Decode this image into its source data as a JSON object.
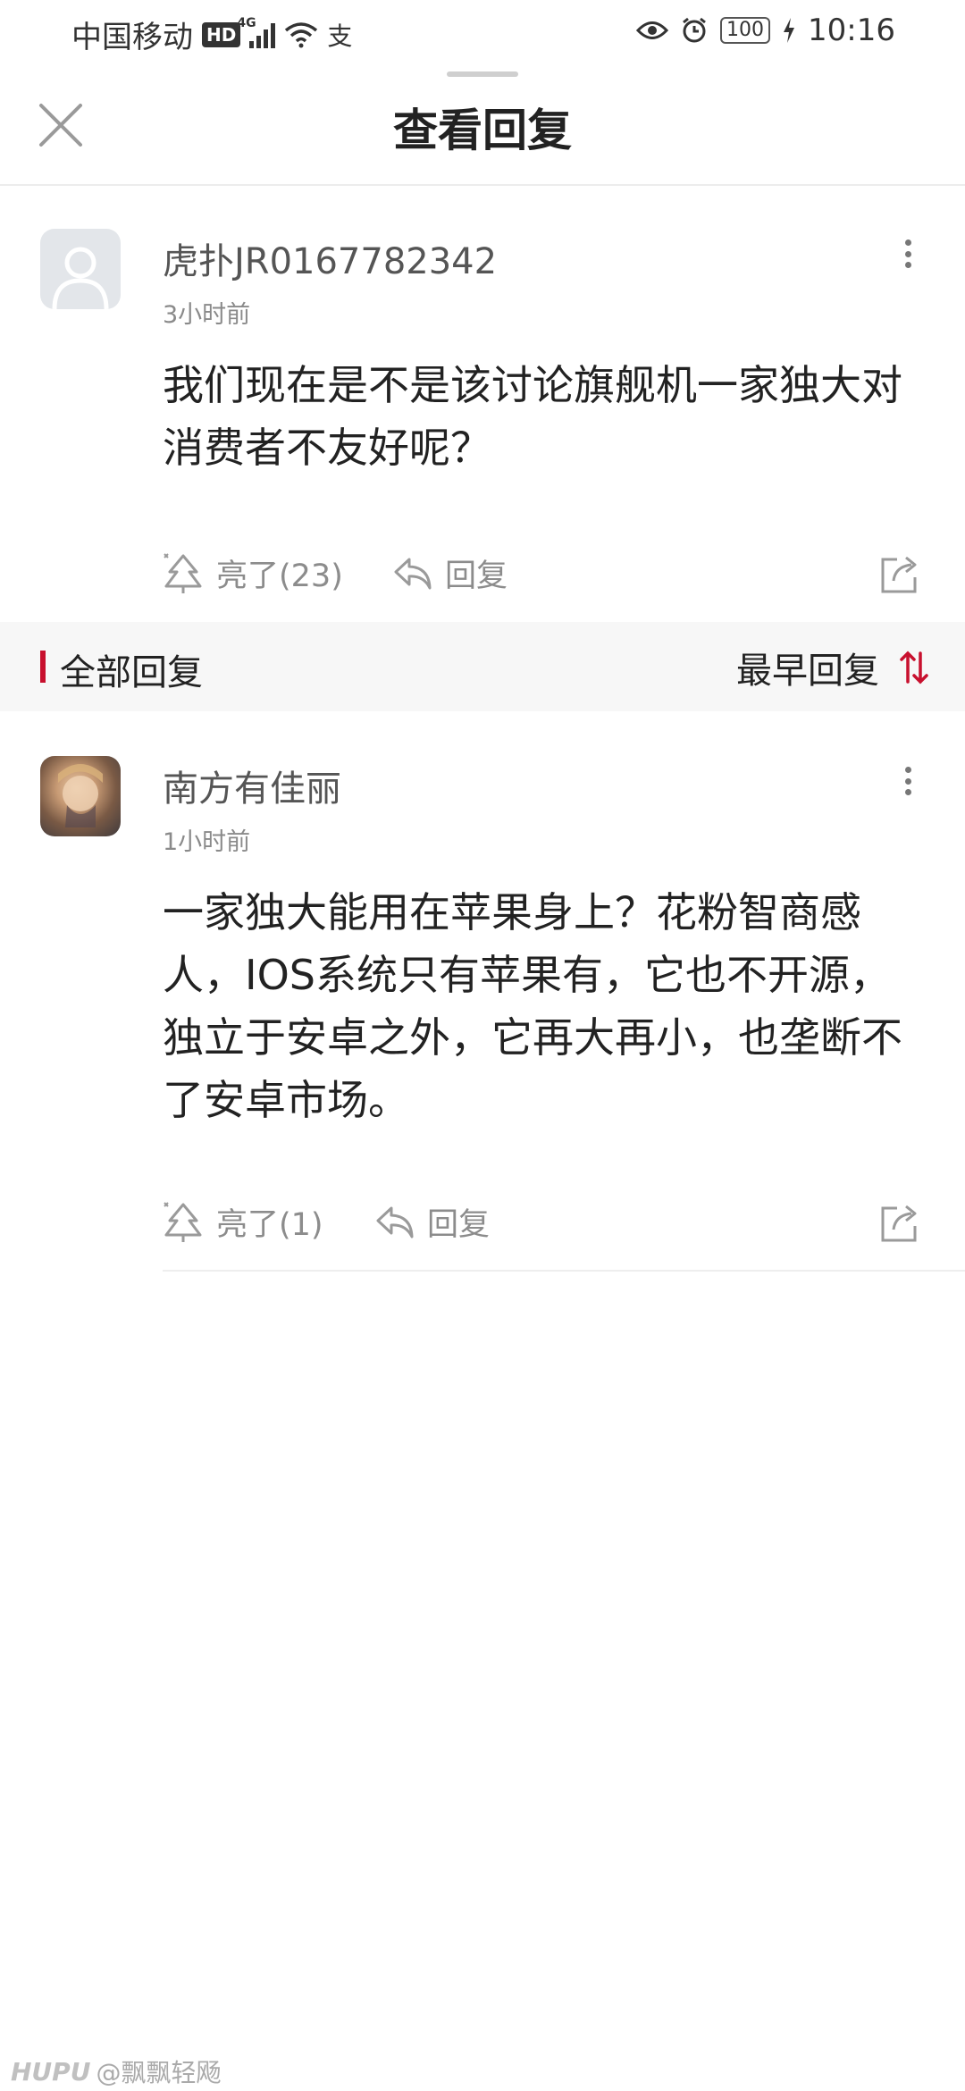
{
  "status_bar": {
    "carrier": "中国移动",
    "hd": "HD",
    "network": "4G",
    "extra_icon": "支",
    "battery": "100",
    "time": "10:16"
  },
  "sheet": {
    "title": "查看回复"
  },
  "original_post": {
    "username": "虎扑JR0167782342",
    "time": "3小时前",
    "text": "我们现在是不是该讨论旗舰机一家独大对消费者不友好呢？",
    "like_label": "亮了(23)",
    "reply_label": "回复"
  },
  "section": {
    "title": "全部回复",
    "sort_label": "最早回复",
    "accent_color": "#c8102e"
  },
  "replies": [
    {
      "username": "南方有佳丽",
      "time": "1小时前",
      "text": "一家独大能用在苹果身上？花粉智商感人，IOS系统只有苹果有，它也不开源，独立于安卓之外，它再大再小，也垄断不了安卓市场。",
      "like_label": "亮了(1)",
      "reply_label": "回复"
    }
  ],
  "watermark": {
    "brand": "HUPU",
    "handle": "@飘飘轻飏"
  }
}
